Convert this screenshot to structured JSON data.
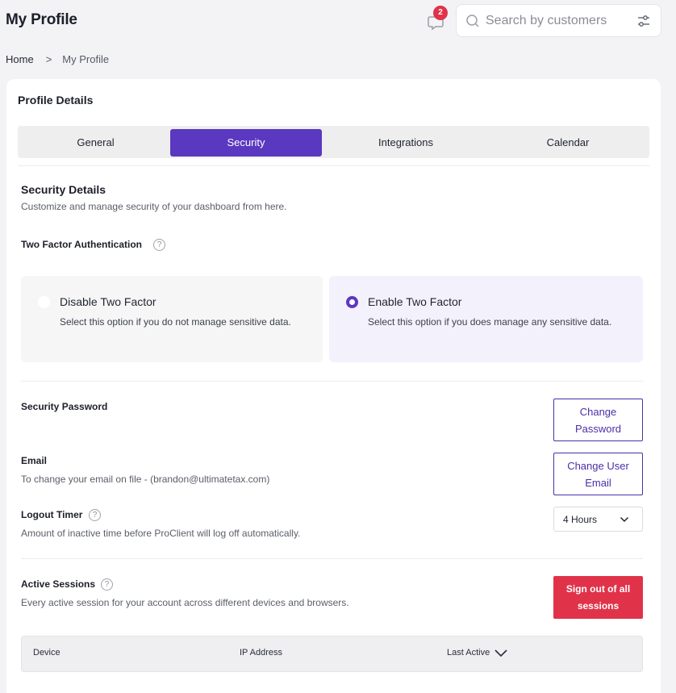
{
  "header": {
    "title": "My Profile",
    "notification_count": "2",
    "search_placeholder": "Search by customers"
  },
  "breadcrumb": {
    "home": "Home",
    "separator": ">",
    "current": "My Profile"
  },
  "profile": {
    "card_title": "Profile Details",
    "tabs": [
      {
        "label": "General",
        "active": false
      },
      {
        "label": "Security",
        "active": true
      },
      {
        "label": "Integrations",
        "active": false
      },
      {
        "label": "Calendar",
        "active": false
      }
    ]
  },
  "security": {
    "title": "Security Details",
    "subtitle": "Customize and manage security of your dashboard from here.",
    "two_factor": {
      "label": "Two Factor Authentication",
      "help": "?",
      "options": [
        {
          "title": "Disable Two Factor",
          "desc": "Select this option if you do not manage sensitive data.",
          "selected": false
        },
        {
          "title": "Enable Two Factor",
          "desc": "Select this option if you does manage any sensitive data.",
          "selected": true
        }
      ]
    },
    "password": {
      "title": "Security Password",
      "button": "Change Password"
    },
    "email": {
      "title": "Email",
      "desc": "To change your email on file - (brandon@ultimatetax.com)",
      "button": "Change User Email"
    },
    "logout_timer": {
      "title": "Logout Timer",
      "help": "?",
      "desc": "Amount of inactive time before ProClient will log off automatically.",
      "value": "4 Hours"
    },
    "sessions": {
      "title": "Active Sessions",
      "help": "?",
      "desc": "Every active session for your account across different devices and browsers.",
      "button": "Sign out of all sessions",
      "columns": [
        "Device",
        "IP Address",
        "Last Active"
      ]
    }
  },
  "colors": {
    "accent": "#5a38c0",
    "danger": "#e0334a",
    "page_bg": "#f3f3f5"
  }
}
